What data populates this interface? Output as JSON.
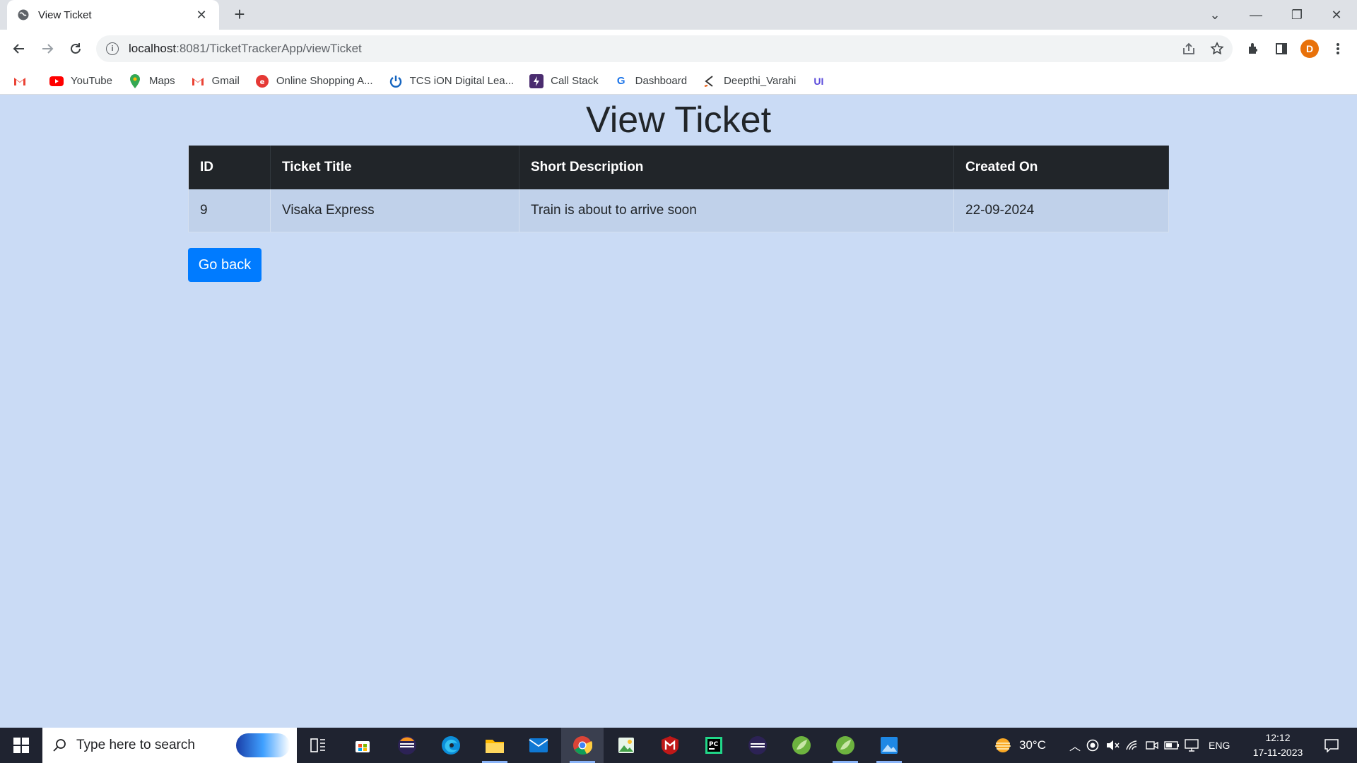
{
  "browser": {
    "tab_title": "View Ticket",
    "url_host": "localhost",
    "url_path": ":8081/TicketTrackerApp/viewTicket",
    "profile_initial": "D",
    "bookmarks": [
      {
        "label": "",
        "icon": "gmail-icon"
      },
      {
        "label": "YouTube",
        "icon": "youtube-icon"
      },
      {
        "label": "Maps",
        "icon": "maps-icon"
      },
      {
        "label": "Gmail",
        "icon": "gmail-icon"
      },
      {
        "label": "Online Shopping A...",
        "icon": "shopping-icon"
      },
      {
        "label": "TCS iON Digital Lea...",
        "icon": "power-icon"
      },
      {
        "label": "Call Stack",
        "icon": "callstack-icon"
      },
      {
        "label": "Dashboard",
        "icon": "g-icon"
      },
      {
        "label": "Deepthi_Varahi",
        "icon": "pen-icon"
      },
      {
        "label": "",
        "icon": "ui-icon"
      }
    ]
  },
  "page": {
    "title": "View Ticket",
    "table": {
      "headers": [
        "ID",
        "Ticket Title",
        "Short Description",
        "Created On"
      ],
      "rows": [
        [
          "9",
          "Visaka Express",
          "Train is about to arrive soon",
          "22-09-2024"
        ]
      ]
    },
    "go_back_label": "Go back"
  },
  "taskbar": {
    "search_placeholder": "Type here to search",
    "weather": "30°C",
    "language": "ENG",
    "time": "12:12",
    "date": "17-11-2023"
  },
  "colors": {
    "page_background": "#cadbf5",
    "table_header": "#212529",
    "button_primary": "#007bff"
  }
}
